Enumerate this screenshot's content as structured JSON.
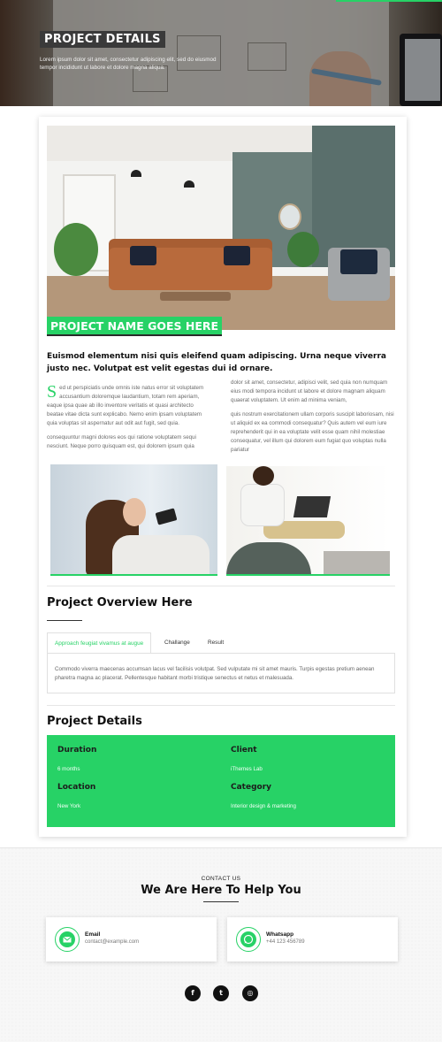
{
  "hero": {
    "title": "PROJECT DETAILS",
    "subtitle": "Lorem ipsum dolor sit amet, consectetur adipiscing elit, sed do eiusmod tempor incididunt ut labore et dolore magna aliqua."
  },
  "project": {
    "name": "PROJECT NAME GOES HERE",
    "lead": "Euismod elementum nisi quis eleifend quam adipiscing. Urna neque viverra justo nec. Volutpat est velit egestas dui id ornare.",
    "col1_dropcap": "S",
    "col1_p1": "ed ut perspiciatis unde omnis iste natus error sit voluptatem accusantium doloremque laudantium, totam rem aperiam, eaque ipsa quae ab illo inventore veritatis et quasi architecto beatae vitae dicta sunt explicabo. Nemo enim ipsam voluptatem quia voluptas sit aspernatur aut odit aut fugit, sed quia.",
    "col1_p2": "consequuntur magni dolores eos qui ratione voluptatem sequi nesciunt. Neque porro quisquam est, qui dolorem ipsum quia",
    "col2_p1": "dolor sit amet, consectetur, adipisci velit, sed quia non numquam eius modi tempora incidunt ut labore et dolore magnam aliquam quaerat voluptatem. Ut enim ad minima veniam,",
    "col2_p2": "quis nostrum exercitationem ullam corporis suscipit laboriosam, nisi ut aliquid ex ea commodi consequatur? Quis autem vel eum iure reprehenderit qui in ea voluptate velit esse quam nihil molestiae consequatur, vel illum qui dolorem eum fugiat quo voluptas nulla pariatur"
  },
  "overview": {
    "title": "Project Overview Here",
    "tabs": [
      {
        "label": "Approach feugiat vivamus at augue"
      },
      {
        "label": "Challange"
      },
      {
        "label": "Result"
      }
    ],
    "panel_text": "Commodo viverra maecenas accumsan lacus vel facilisis volutpat. Sed vulputate mi sit amet mauris. Turpis egestas pretium aenean pharetra magna ac placerat. Pellentesque habitant morbi tristique senectus et netus et malesuada."
  },
  "details": {
    "title": "Project Details",
    "items": [
      {
        "label": "Duration",
        "value": "6 months"
      },
      {
        "label": "Client",
        "value": "iThemes Lab"
      },
      {
        "label": "Location",
        "value": "New York"
      },
      {
        "label": "Category",
        "value": "Interior design & marketing"
      }
    ]
  },
  "contact": {
    "eyebrow": "CONTACT US",
    "title": "We Are Here To Help You",
    "cards": [
      {
        "icon": "envelope-icon",
        "title": "Email",
        "value": "contact@example.com"
      },
      {
        "icon": "whatsapp-icon",
        "title": "Whatsapp",
        "value": "+44 123 456789"
      }
    ],
    "social": [
      {
        "icon": "facebook-icon",
        "glyph": "f"
      },
      {
        "icon": "twitter-icon",
        "glyph": "t"
      },
      {
        "icon": "instagram-icon",
        "glyph": "◎"
      }
    ]
  },
  "colors": {
    "accent": "#27d266",
    "dark": "#111111"
  }
}
